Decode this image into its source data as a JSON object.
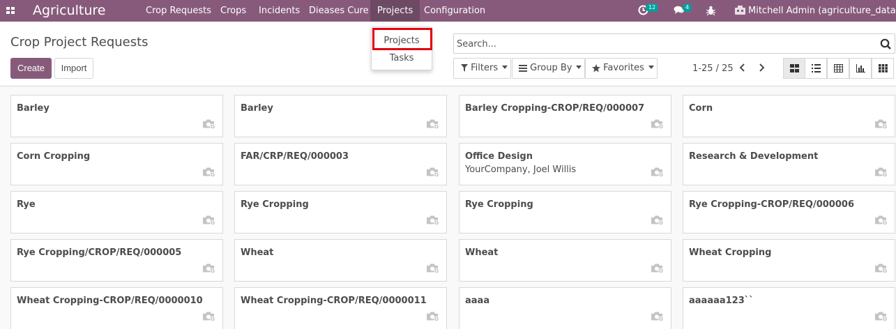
{
  "navbar": {
    "brand": "Agriculture",
    "menu": [
      "Crop Requests",
      "Crops",
      "Incidents",
      "Dieases Cure",
      "Projects",
      "Configuration"
    ],
    "activity_count": "12",
    "message_count": "4",
    "user": "Mitchell Admin (agriculture_datas)"
  },
  "dropdown": {
    "items": [
      "Projects",
      "Tasks"
    ]
  },
  "control_panel": {
    "breadcrumb": "Crop Project Requests",
    "create_label": "Create",
    "import_label": "Import",
    "search_placeholder": "Search...",
    "filters_label": "Filters",
    "group_by_label": "Group By",
    "favorites_label": "Favorites",
    "pager": "1-25 / 25"
  },
  "views": [
    "kanban-view",
    "list-view",
    "pivot-view",
    "graph-view",
    "dashboard-view"
  ],
  "accent_color": "#875a7b",
  "cards": [
    {
      "title": "Barley",
      "subtitle": ""
    },
    {
      "title": "Barley",
      "subtitle": ""
    },
    {
      "title": "Barley Cropping-CROP/REQ/000007",
      "subtitle": ""
    },
    {
      "title": "Corn",
      "subtitle": ""
    },
    {
      "title": "Corn Cropping",
      "subtitle": ""
    },
    {
      "title": "FAR/CRP/REQ/000003",
      "subtitle": ""
    },
    {
      "title": "Office Design",
      "subtitle": "YourCompany, Joel Willis"
    },
    {
      "title": "Research & Development",
      "subtitle": ""
    },
    {
      "title": "Rye",
      "subtitle": ""
    },
    {
      "title": "Rye Cropping",
      "subtitle": ""
    },
    {
      "title": "Rye Cropping",
      "subtitle": ""
    },
    {
      "title": "Rye Cropping-CROP/REQ/000006",
      "subtitle": ""
    },
    {
      "title": "Rye Cropping/CROP/REQ/000005",
      "subtitle": ""
    },
    {
      "title": "Wheat",
      "subtitle": ""
    },
    {
      "title": "Wheat",
      "subtitle": ""
    },
    {
      "title": "Wheat Cropping",
      "subtitle": ""
    },
    {
      "title": "Wheat Cropping-CROP/REQ/0000010",
      "subtitle": ""
    },
    {
      "title": "Wheat Cropping-CROP/REQ/0000011",
      "subtitle": ""
    },
    {
      "title": "aaaa",
      "subtitle": ""
    },
    {
      "title": "aaaaaa123``",
      "subtitle": ""
    }
  ]
}
